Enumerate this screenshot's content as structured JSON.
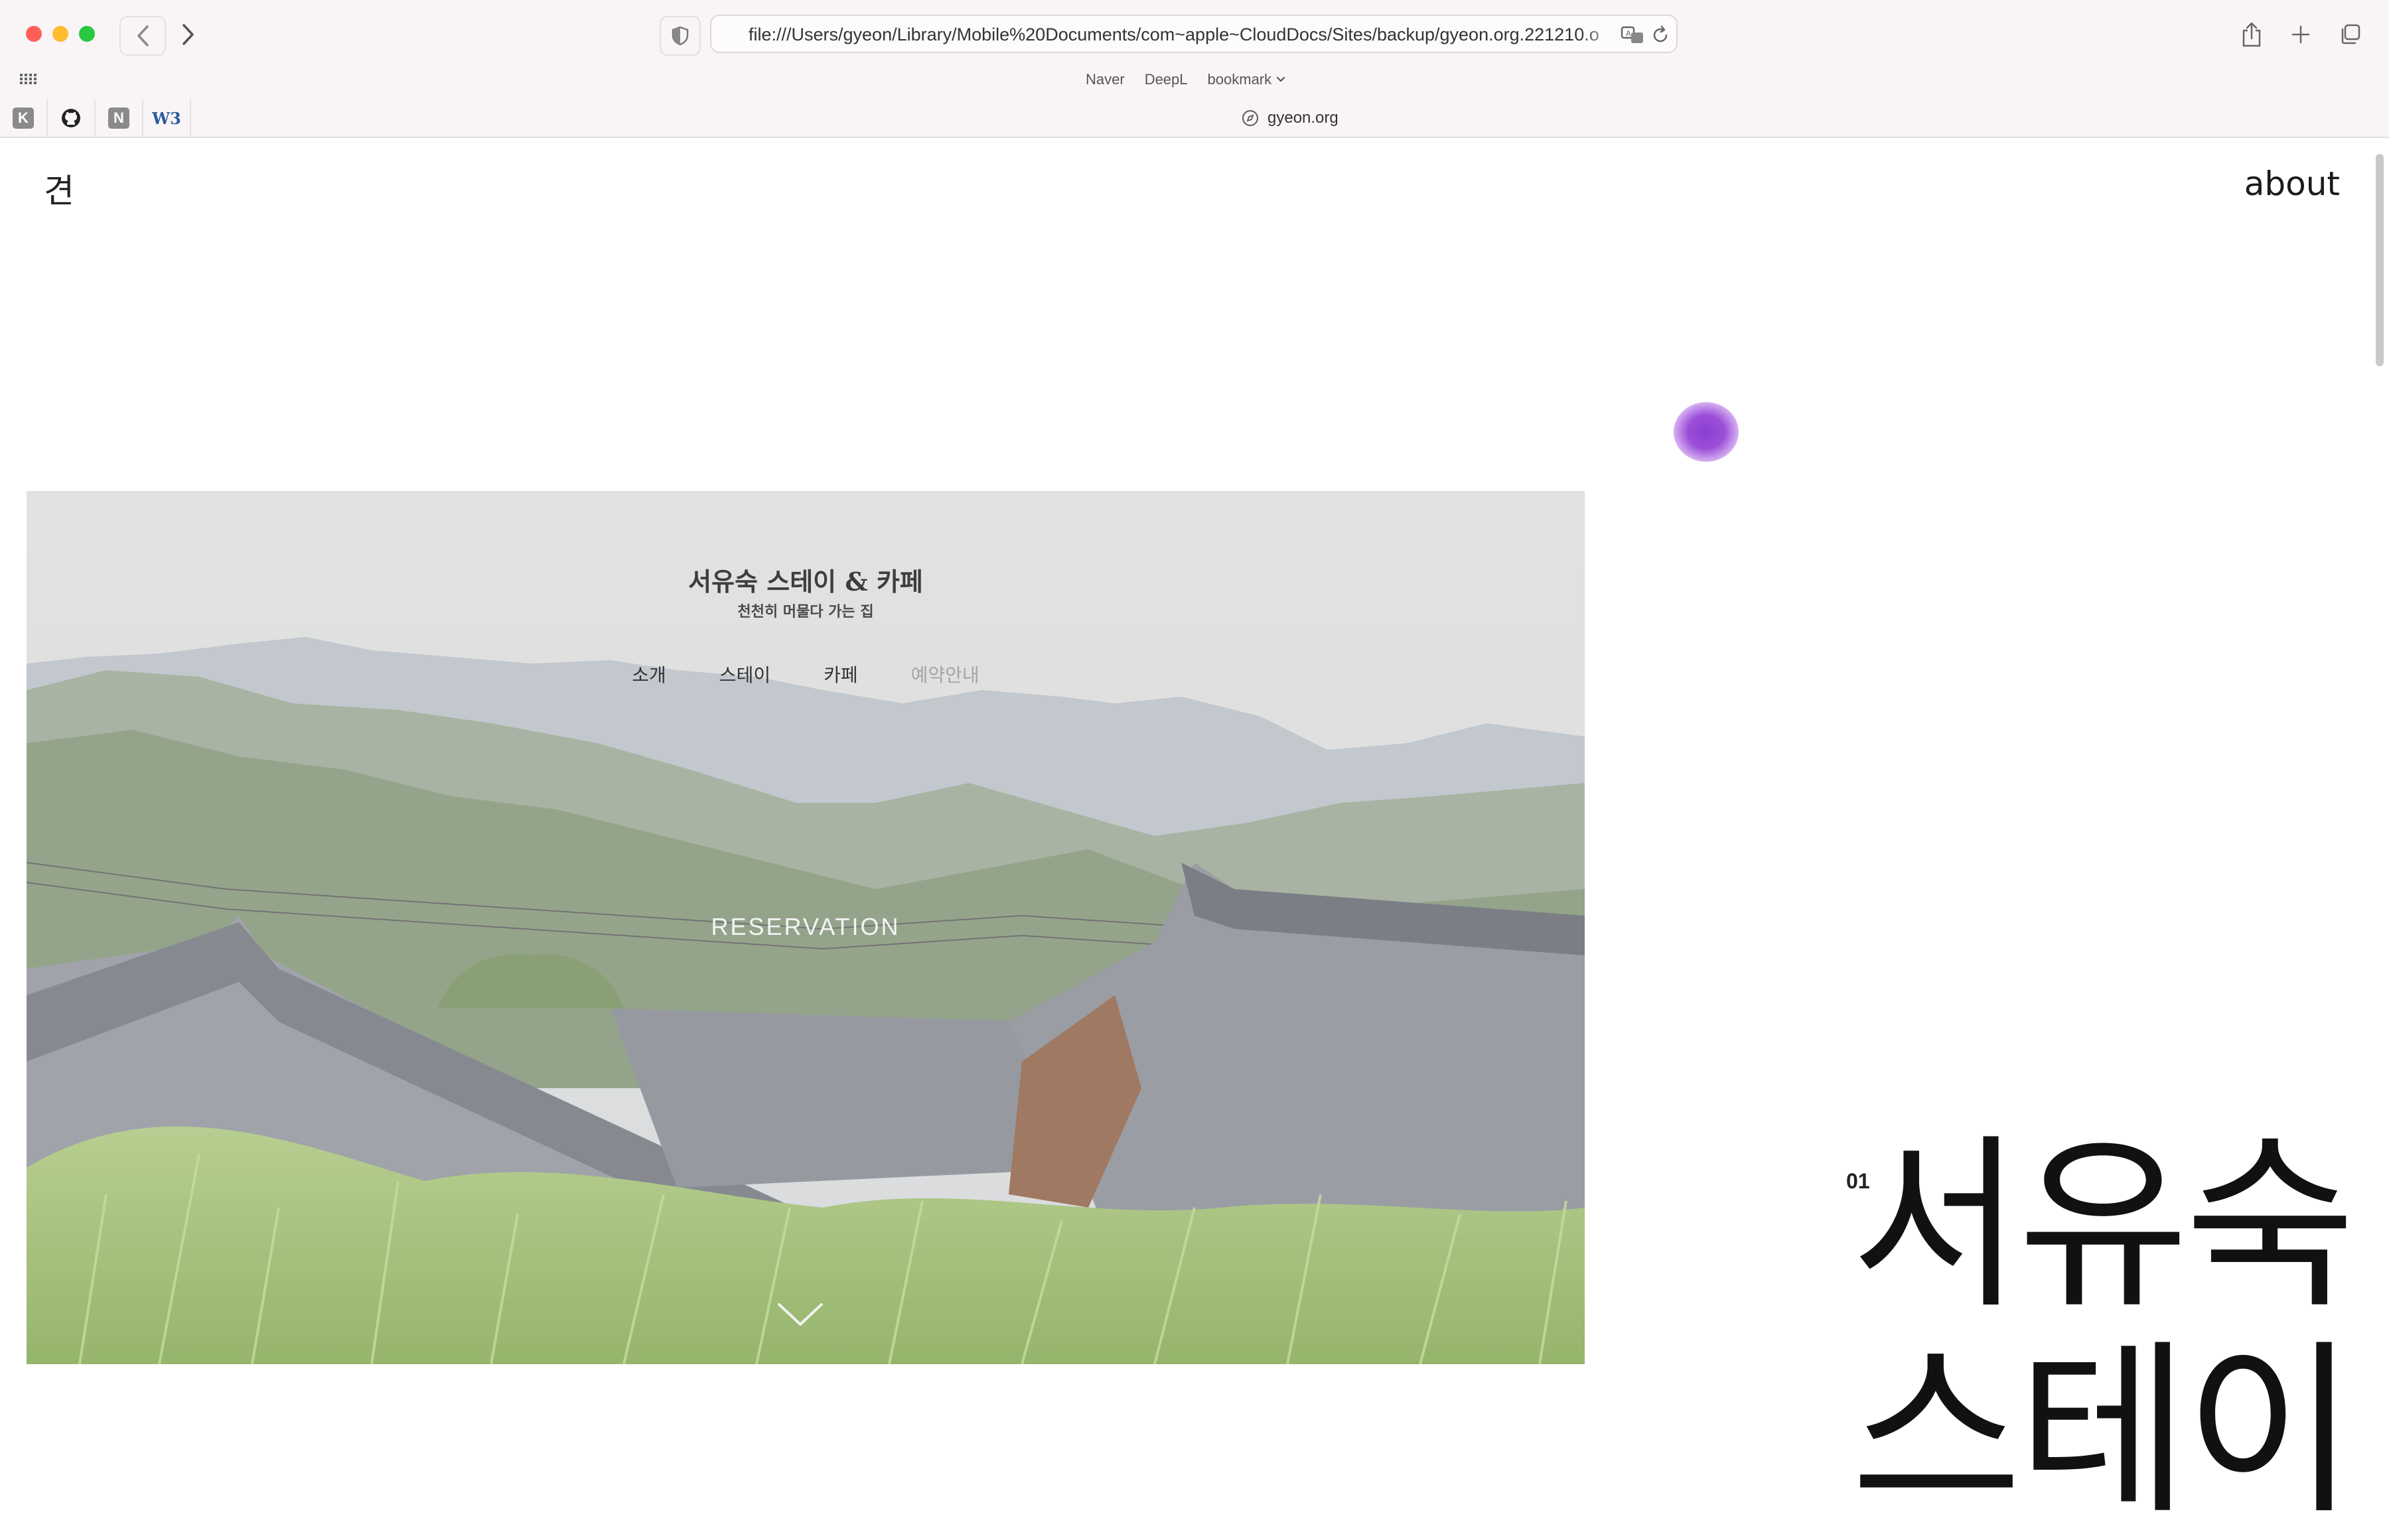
{
  "browser": {
    "url": "file:///Users/gyeon/Library/Mobile%20Documents/com~apple~CloudDocs/Sites/backup/gyeon.org.221210.o",
    "tab_title": "gyeon.org",
    "bookmarks": [
      "Naver",
      "DeepL",
      "bookmark"
    ],
    "favorites": [
      {
        "label": "K",
        "icon": "kakao-k-icon"
      },
      {
        "label": "",
        "icon": "github-icon"
      },
      {
        "label": "N",
        "icon": "notion-n-icon"
      },
      {
        "label": "W3",
        "icon": "w3schools-icon"
      }
    ]
  },
  "site": {
    "logo": "견",
    "about_link": "about",
    "hero": {
      "title": "서유숙 스테이 & 카페",
      "subtitle": "천천히 머물다 가는 집",
      "nav": [
        "소개",
        "스테이",
        "카페",
        "예약안내"
      ],
      "cta": "RESERVATION"
    },
    "project_number": "01",
    "project_title_line1": "서유숙",
    "project_title_line2": "스테이"
  },
  "colors": {
    "cursor_highlight": "#9b4fd9",
    "chrome_bg": "#f9f5f7"
  }
}
